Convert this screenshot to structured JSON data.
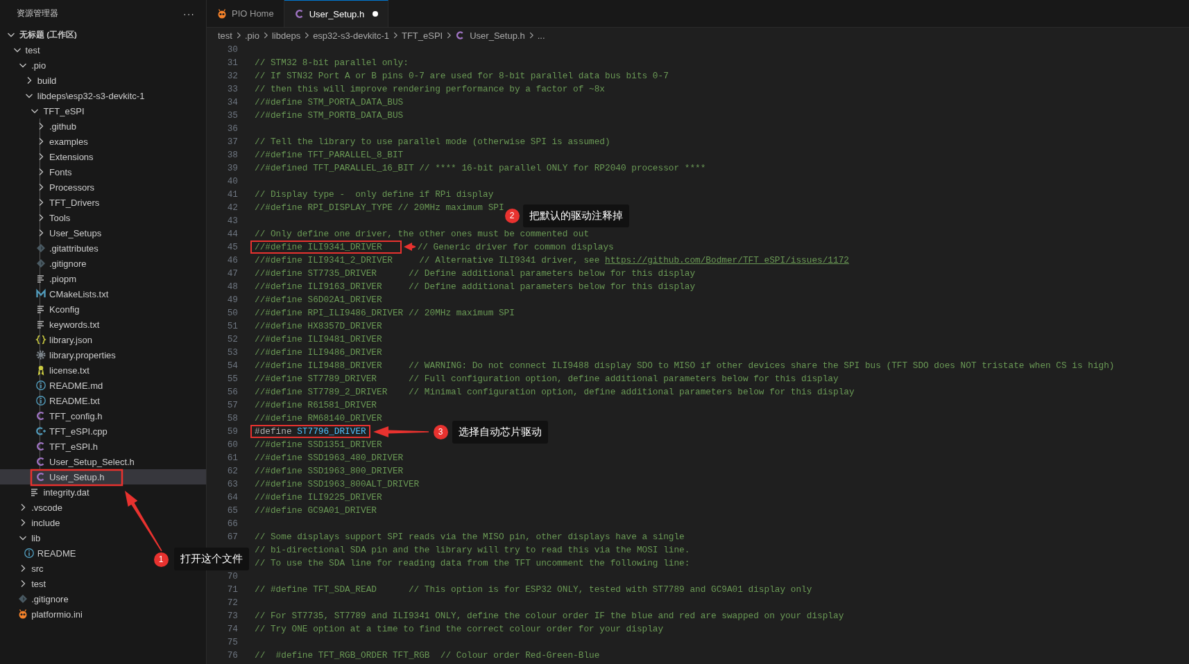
{
  "sidebar": {
    "title": "资源管理器",
    "more": "···",
    "tree": [
      {
        "label": "无标题 (工作区)",
        "kind": "workspace",
        "expanded": true,
        "selected": false,
        "children": [
          {
            "label": "test",
            "kind": "folder",
            "expanded": true,
            "selected": false,
            "children": [
              {
                "label": ".pio",
                "kind": "folder",
                "expanded": true,
                "selected": false,
                "children": [
                  {
                    "label": "build",
                    "kind": "folder",
                    "expanded": false,
                    "selected": false
                  },
                  {
                    "label": "libdeps\\esp32-s3-devkitc-1",
                    "kind": "folder",
                    "expanded": true,
                    "selected": false,
                    "children": [
                      {
                        "label": "TFT_eSPI",
                        "kind": "folder",
                        "expanded": true,
                        "selected": false,
                        "children": [
                          {
                            "label": ".github",
                            "kind": "folder",
                            "expanded": false,
                            "selected": false
                          },
                          {
                            "label": "examples",
                            "kind": "folder",
                            "expanded": false,
                            "selected": false
                          },
                          {
                            "label": "Extensions",
                            "kind": "folder",
                            "expanded": false,
                            "selected": false
                          },
                          {
                            "label": "Fonts",
                            "kind": "folder",
                            "expanded": false,
                            "selected": false
                          },
                          {
                            "label": "Processors",
                            "kind": "folder",
                            "expanded": false,
                            "selected": false
                          },
                          {
                            "label": "TFT_Drivers",
                            "kind": "folder",
                            "expanded": false,
                            "selected": false
                          },
                          {
                            "label": "Tools",
                            "kind": "folder",
                            "expanded": false,
                            "selected": false
                          },
                          {
                            "label": "User_Setups",
                            "kind": "folder",
                            "expanded": false,
                            "selected": false
                          },
                          {
                            "label": ".gitattributes",
                            "kind": "git",
                            "selected": false
                          },
                          {
                            "label": ".gitignore",
                            "kind": "git",
                            "selected": false
                          },
                          {
                            "label": ".piopm",
                            "kind": "text",
                            "selected": false
                          },
                          {
                            "label": "CMakeLists.txt",
                            "kind": "cmake",
                            "selected": false
                          },
                          {
                            "label": "Kconfig",
                            "kind": "text",
                            "selected": false
                          },
                          {
                            "label": "keywords.txt",
                            "kind": "text",
                            "selected": false
                          },
                          {
                            "label": "library.json",
                            "kind": "json",
                            "selected": false
                          },
                          {
                            "label": "library.properties",
                            "kind": "gear",
                            "selected": false
                          },
                          {
                            "label": "license.txt",
                            "kind": "license",
                            "selected": false
                          },
                          {
                            "label": "README.md",
                            "kind": "info",
                            "selected": false
                          },
                          {
                            "label": "README.txt",
                            "kind": "info",
                            "selected": false
                          },
                          {
                            "label": "TFT_config.h",
                            "kind": "c",
                            "selected": false
                          },
                          {
                            "label": "TFT_eSPI.cpp",
                            "kind": "cpp",
                            "selected": false
                          },
                          {
                            "label": "TFT_eSPI.h",
                            "kind": "c",
                            "selected": false
                          },
                          {
                            "label": "User_Setup_Select.h",
                            "kind": "c",
                            "selected": false
                          },
                          {
                            "label": "User_Setup.h",
                            "kind": "c",
                            "selected": true
                          }
                        ]
                      },
                      {
                        "label": "integrity.dat",
                        "kind": "text",
                        "selected": false
                      }
                    ]
                  }
                ]
              },
              {
                "label": ".vscode",
                "kind": "folder",
                "expanded": false,
                "selected": false
              },
              {
                "label": "include",
                "kind": "folder",
                "expanded": false,
                "selected": false
              },
              {
                "label": "lib",
                "kind": "folder",
                "expanded": true,
                "selected": false,
                "children": [
                  {
                    "label": "README",
                    "kind": "info",
                    "selected": false
                  }
                ]
              },
              {
                "label": "src",
                "kind": "folder",
                "expanded": false,
                "selected": false
              },
              {
                "label": "test",
                "kind": "folder",
                "expanded": false,
                "selected": false
              },
              {
                "label": ".gitignore",
                "kind": "git",
                "selected": false
              },
              {
                "label": "platformio.ini",
                "kind": "pio",
                "selected": false
              }
            ]
          }
        ]
      }
    ]
  },
  "tabs": [
    {
      "label": "PIO Home",
      "kind": "pio",
      "selected": false,
      "modified": false
    },
    {
      "label": "User_Setup.h",
      "kind": "c",
      "selected": true,
      "modified": true
    }
  ],
  "breadcrumb": [
    {
      "label": "test",
      "kind": "folder"
    },
    {
      "label": ".pio",
      "kind": "folder"
    },
    {
      "label": "libdeps",
      "kind": "folder"
    },
    {
      "label": "esp32-s3-devkitc-1",
      "kind": "folder"
    },
    {
      "label": "TFT_eSPI",
      "kind": "folder"
    },
    {
      "label": "User_Setup.h",
      "kind": "c"
    },
    {
      "label": "...",
      "kind": "more"
    }
  ],
  "code": [
    {
      "num": "30"
    },
    {
      "num": "31",
      "segments": [
        {
          "kind": "comment",
          "framed": false,
          "text": "// STM32 8-bit parallel only:"
        }
      ]
    },
    {
      "num": "32",
      "segments": [
        {
          "kind": "comment",
          "framed": false,
          "text": "// If STN32 Port A or B pins 0-7 are used for 8-bit parallel data bus bits 0-7"
        }
      ]
    },
    {
      "num": "33",
      "segments": [
        {
          "kind": "comment",
          "framed": false,
          "text": "// then this will improve rendering performance by a factor of ~8x"
        }
      ]
    },
    {
      "num": "34",
      "segments": [
        {
          "kind": "comment",
          "framed": false,
          "text": "//#define STM_PORTA_DATA_BUS"
        }
      ]
    },
    {
      "num": "35",
      "segments": [
        {
          "kind": "comment",
          "framed": false,
          "text": "//#define STM_PORTB_DATA_BUS"
        }
      ]
    },
    {
      "num": "36"
    },
    {
      "num": "37",
      "segments": [
        {
          "kind": "comment",
          "framed": false,
          "text": "// Tell the library to use parallel mode (otherwise SPI is assumed)"
        }
      ]
    },
    {
      "num": "38",
      "segments": [
        {
          "kind": "comment",
          "framed": false,
          "text": "//#define TFT_PARALLEL_8_BIT"
        }
      ]
    },
    {
      "num": "39",
      "segments": [
        {
          "kind": "comment",
          "framed": false,
          "text": "//#defined TFT_PARALLEL_16_BIT // **** 16-bit parallel ONLY for RP2040 processor ****"
        }
      ]
    },
    {
      "num": "40"
    },
    {
      "num": "41",
      "segments": [
        {
          "kind": "comment",
          "framed": false,
          "text": "// Display type -  only define if RPi display"
        }
      ]
    },
    {
      "num": "42",
      "segments": [
        {
          "kind": "comment",
          "framed": false,
          "text": "//#define RPI_DISPLAY_TYPE // 20MHz maximum SPI"
        }
      ]
    },
    {
      "num": "43"
    },
    {
      "num": "44",
      "segments": [
        {
          "kind": "comment",
          "framed": false,
          "text": "// Only define one driver, the other ones must be commented out"
        }
      ]
    },
    {
      "num": "45",
      "segments": [
        {
          "kind": "comment",
          "framed": true,
          "text": "//#define ILI9341_DRIVER"
        },
        {
          "kind": "comment",
          "framed": false,
          "text": "// Generic driver for common displays"
        }
      ]
    },
    {
      "num": "46",
      "segments": [
        {
          "kind": "comment",
          "framed": false,
          "text": "//#define ILI9341_2_DRIVER     // Alternative ILI9341 driver, see "
        },
        {
          "kind": "link",
          "framed": false,
          "text": "https://github.com/Bodmer/TFT_eSPI/issues/1172"
        }
      ]
    },
    {
      "num": "47",
      "segments": [
        {
          "kind": "comment",
          "framed": false,
          "text": "//#define ST7735_DRIVER      // Define additional parameters below for this display"
        }
      ]
    },
    {
      "num": "48",
      "segments": [
        {
          "kind": "comment",
          "framed": false,
          "text": "//#define ILI9163_DRIVER     // Define additional parameters below for this display"
        }
      ]
    },
    {
      "num": "49",
      "segments": [
        {
          "kind": "comment",
          "framed": false,
          "text": "//#define S6D02A1_DRIVER"
        }
      ]
    },
    {
      "num": "50",
      "segments": [
        {
          "kind": "comment",
          "framed": false,
          "text": "//#define RPI_ILI9486_DRIVER // 20MHz maximum SPI"
        }
      ]
    },
    {
      "num": "51",
      "segments": [
        {
          "kind": "comment",
          "framed": false,
          "text": "//#define HX8357D_DRIVER"
        }
      ]
    },
    {
      "num": "52",
      "segments": [
        {
          "kind": "comment",
          "framed": false,
          "text": "//#define ILI9481_DRIVER"
        }
      ]
    },
    {
      "num": "53",
      "segments": [
        {
          "kind": "comment",
          "framed": false,
          "text": "//#define ILI9486_DRIVER"
        }
      ]
    },
    {
      "num": "54",
      "segments": [
        {
          "kind": "comment",
          "framed": false,
          "text": "//#define ILI9488_DRIVER     // WARNING: Do not connect ILI9488 display SDO to MISO if other devices share the SPI bus (TFT SDO does NOT tristate when CS is high)"
        }
      ]
    },
    {
      "num": "55",
      "segments": [
        {
          "kind": "comment",
          "framed": false,
          "text": "//#define ST7789_DRIVER      // Full configuration option, define additional parameters below for this display"
        }
      ]
    },
    {
      "num": "56",
      "segments": [
        {
          "kind": "comment",
          "framed": false,
          "text": "//#define ST7789_2_DRIVER    // Minimal configuration option, define additional parameters below for this display"
        }
      ]
    },
    {
      "num": "57",
      "segments": [
        {
          "kind": "comment",
          "framed": false,
          "text": "//#define R61581_DRIVER"
        }
      ]
    },
    {
      "num": "58",
      "segments": [
        {
          "kind": "comment",
          "framed": false,
          "text": "//#define RM68140_DRIVER"
        }
      ]
    },
    {
      "num": "59",
      "segments": [
        {
          "kind": "directive",
          "framed": true,
          "text": "#define "
        },
        {
          "kind": "macro",
          "framed": true,
          "text": "ST7796_DRIVER"
        }
      ]
    },
    {
      "num": "60",
      "segments": [
        {
          "kind": "comment",
          "framed": false,
          "text": "//#define SSD1351_DRIVER"
        }
      ]
    },
    {
      "num": "61",
      "segments": [
        {
          "kind": "comment",
          "framed": false,
          "text": "//#define SSD1963_480_DRIVER"
        }
      ]
    },
    {
      "num": "62",
      "segments": [
        {
          "kind": "comment",
          "framed": false,
          "text": "//#define SSD1963_800_DRIVER"
        }
      ]
    },
    {
      "num": "63",
      "segments": [
        {
          "kind": "comment",
          "framed": false,
          "text": "//#define SSD1963_800ALT_DRIVER"
        }
      ]
    },
    {
      "num": "64",
      "segments": [
        {
          "kind": "comment",
          "framed": false,
          "text": "//#define ILI9225_DRIVER"
        }
      ]
    },
    {
      "num": "65",
      "segments": [
        {
          "kind": "comment",
          "framed": false,
          "text": "//#define GC9A01_DRIVER"
        }
      ]
    },
    {
      "num": "66"
    },
    {
      "num": "67",
      "segments": [
        {
          "kind": "comment",
          "framed": false,
          "text": "// Some displays support SPI reads via the MISO pin, other displays have a single"
        }
      ]
    },
    {
      "segments": [
        {
          "kind": "comment",
          "framed": false,
          "text": "// bi-directional SDA pin and the library will try to read this via the MOSI line."
        }
      ]
    },
    {
      "segments": [
        {
          "kind": "comment",
          "framed": false,
          "text": "// To use the SDA line for reading data from the TFT uncomment the following line:"
        }
      ]
    },
    {
      "num": "70"
    },
    {
      "num": "71",
      "segments": [
        {
          "kind": "comment",
          "framed": false,
          "text": "// #define TFT_SDA_READ      // This option is for ESP32 ONLY, tested with ST7789 and GC9A01 display only"
        }
      ]
    },
    {
      "num": "72"
    },
    {
      "num": "73",
      "segments": [
        {
          "kind": "comment",
          "framed": false,
          "text": "// For ST7735, ST7789 and ILI9341 ONLY, define the colour order IF the blue and red are swapped on your display"
        }
      ]
    },
    {
      "num": "74",
      "segments": [
        {
          "kind": "comment",
          "framed": false,
          "text": "// Try ONE option at a time to find the correct colour order for your display"
        }
      ]
    },
    {
      "num": "75"
    },
    {
      "num": "76",
      "segments": [
        {
          "kind": "comment",
          "framed": false,
          "text": "//  #define TFT_RGB_ORDER TFT_RGB  // Colour order Red-Green-Blue"
        }
      ]
    }
  ],
  "annotations": [
    {
      "number": "1",
      "text": "打开这个文件"
    },
    {
      "number": "2",
      "text": "把默认的驱动注释掉"
    },
    {
      "number": "3",
      "text": "选择自动芯片驱动"
    }
  ]
}
